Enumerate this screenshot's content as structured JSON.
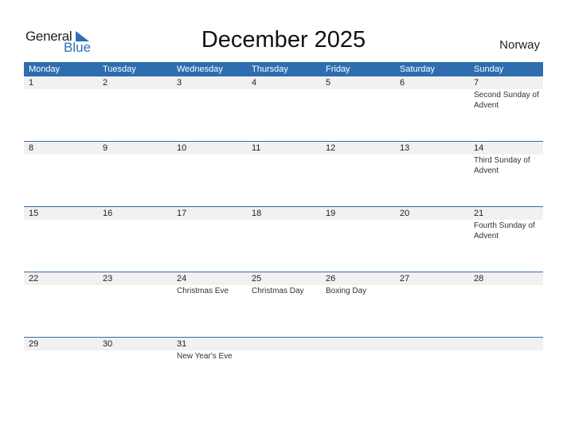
{
  "logo": {
    "general": "General",
    "blue": "Blue"
  },
  "title": "December 2025",
  "country": "Norway",
  "colors": {
    "header_bg": "#2e6db0",
    "brand_blue": "#2b6fb5",
    "day_row_bg": "#f1f1f1"
  },
  "weekdays": [
    "Monday",
    "Tuesday",
    "Wednesday",
    "Thursday",
    "Friday",
    "Saturday",
    "Sunday"
  ],
  "weeks": [
    [
      {
        "day": "1",
        "holiday": ""
      },
      {
        "day": "2",
        "holiday": ""
      },
      {
        "day": "3",
        "holiday": ""
      },
      {
        "day": "4",
        "holiday": ""
      },
      {
        "day": "5",
        "holiday": ""
      },
      {
        "day": "6",
        "holiday": ""
      },
      {
        "day": "7",
        "holiday": "Second Sunday of Advent"
      }
    ],
    [
      {
        "day": "8",
        "holiday": ""
      },
      {
        "day": "9",
        "holiday": ""
      },
      {
        "day": "10",
        "holiday": ""
      },
      {
        "day": "11",
        "holiday": ""
      },
      {
        "day": "12",
        "holiday": ""
      },
      {
        "day": "13",
        "holiday": ""
      },
      {
        "day": "14",
        "holiday": "Third Sunday of Advent"
      }
    ],
    [
      {
        "day": "15",
        "holiday": ""
      },
      {
        "day": "16",
        "holiday": ""
      },
      {
        "day": "17",
        "holiday": ""
      },
      {
        "day": "18",
        "holiday": ""
      },
      {
        "day": "19",
        "holiday": ""
      },
      {
        "day": "20",
        "holiday": ""
      },
      {
        "day": "21",
        "holiday": "Fourth Sunday of Advent"
      }
    ],
    [
      {
        "day": "22",
        "holiday": ""
      },
      {
        "day": "23",
        "holiday": ""
      },
      {
        "day": "24",
        "holiday": "Christmas Eve"
      },
      {
        "day": "25",
        "holiday": "Christmas Day"
      },
      {
        "day": "26",
        "holiday": "Boxing Day"
      },
      {
        "day": "27",
        "holiday": ""
      },
      {
        "day": "28",
        "holiday": ""
      }
    ],
    [
      {
        "day": "29",
        "holiday": ""
      },
      {
        "day": "30",
        "holiday": ""
      },
      {
        "day": "31",
        "holiday": "New Year's Eve"
      },
      {
        "day": "",
        "holiday": ""
      },
      {
        "day": "",
        "holiday": ""
      },
      {
        "day": "",
        "holiday": ""
      },
      {
        "day": "",
        "holiday": ""
      }
    ]
  ]
}
